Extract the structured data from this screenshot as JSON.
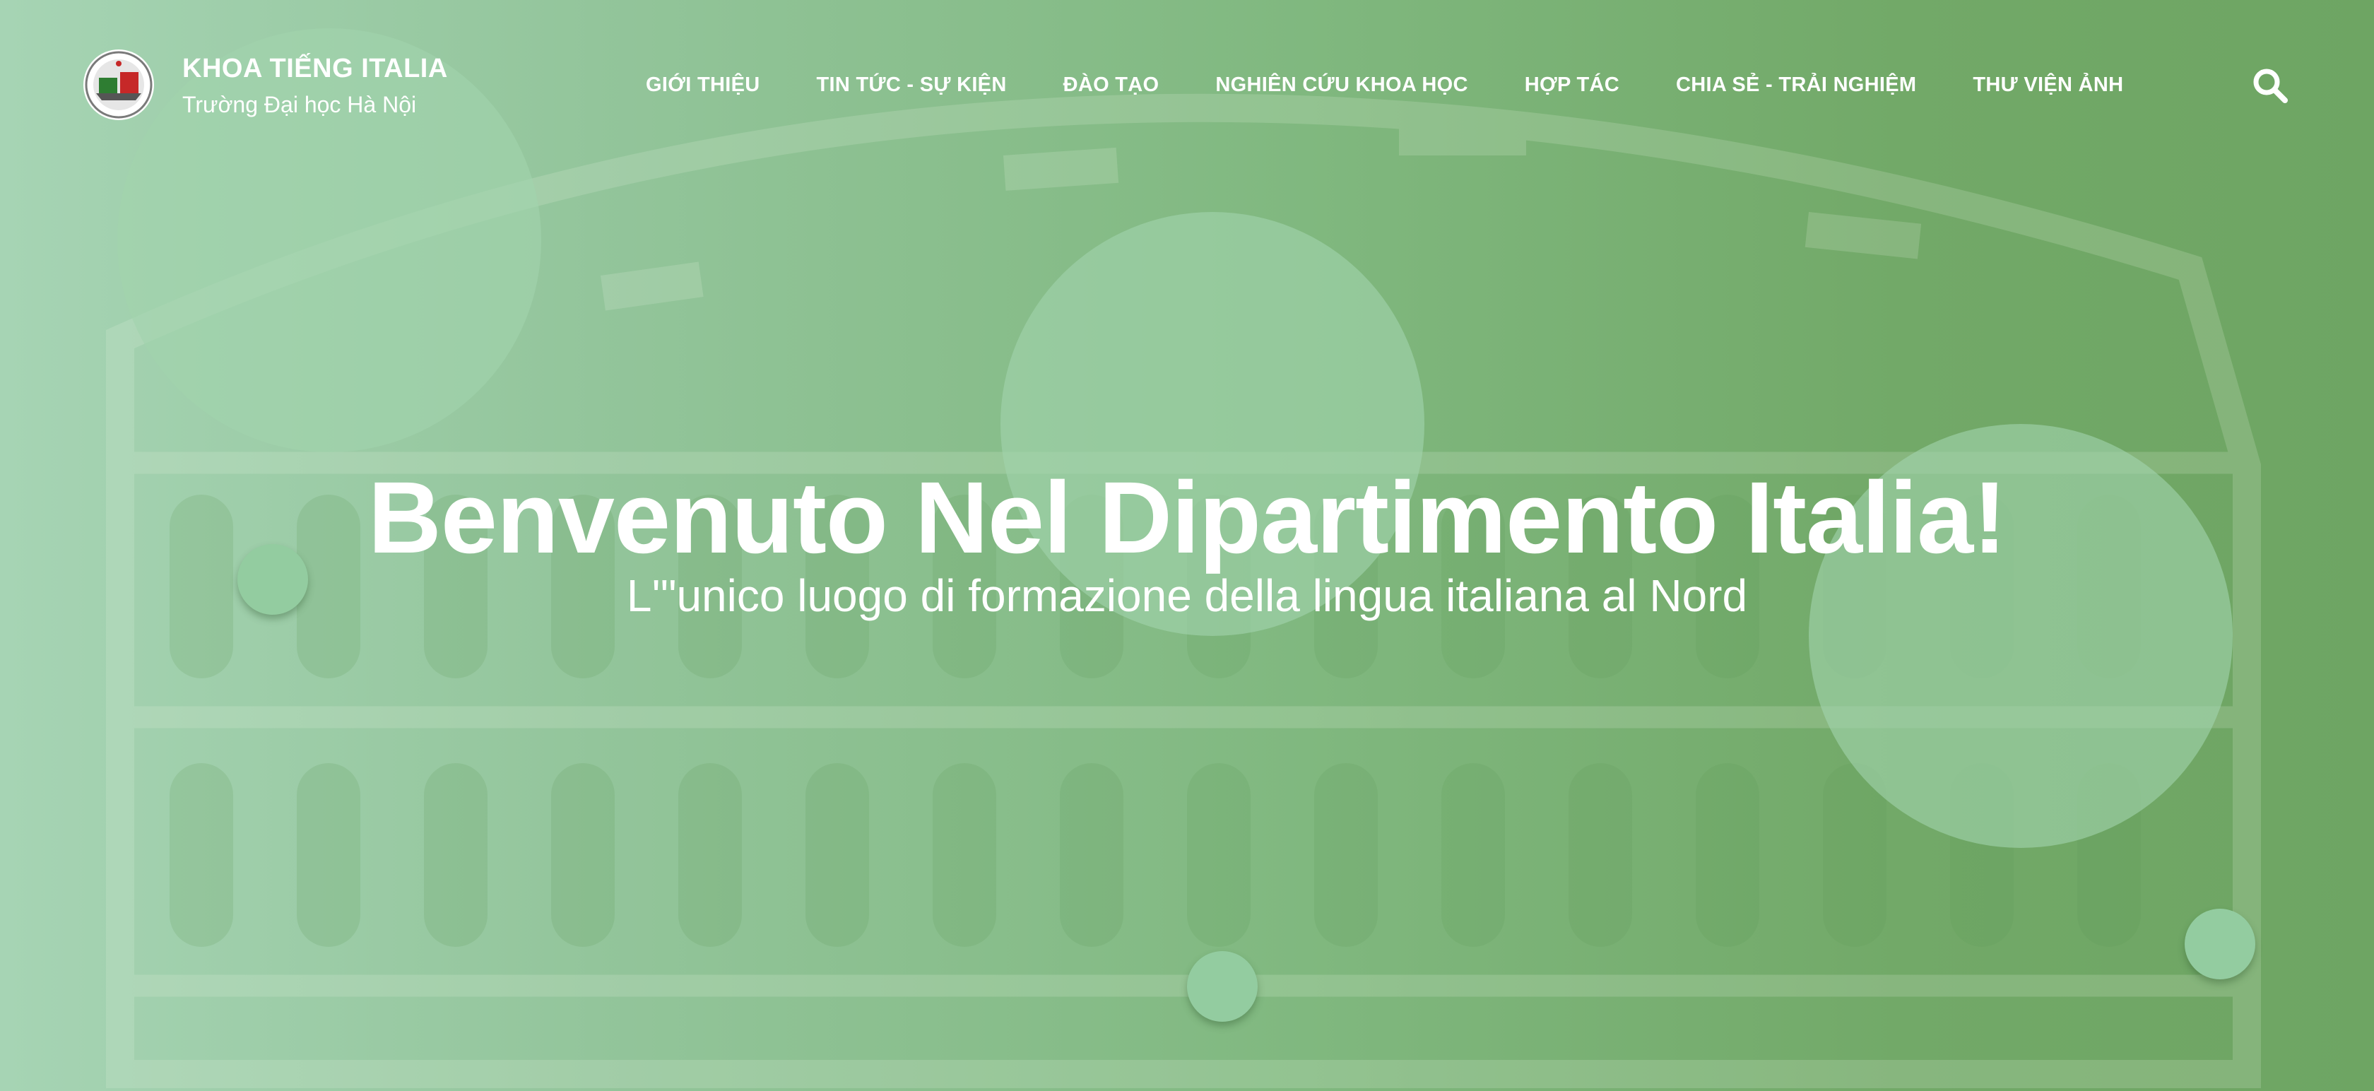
{
  "brand": {
    "title": "KHOA TIẾNG ITALIA",
    "subtitle": "Trường Đại học Hà Nội"
  },
  "nav": {
    "items": [
      {
        "label": "GIỚI THIỆU"
      },
      {
        "label": "TIN TỨC - SỰ KIỆN"
      },
      {
        "label": "ĐÀO TẠO"
      },
      {
        "label": "NGHIÊN CỨU KHOA HỌC"
      },
      {
        "label": "HỢP TÁC"
      },
      {
        "label": "CHIA SẺ - TRẢI NGHIỆM"
      },
      {
        "label": "THƯ VIỆN ẢNH"
      }
    ]
  },
  "search": {
    "icon": "search-icon"
  },
  "hero": {
    "title": "Benvenuto Nel Dipartimento Italia!",
    "subtitle": "L'\"unico luogo di formazione della lingua italiana al Nord"
  },
  "colors": {
    "background_left": "#a6d4b4",
    "background_right": "#6ea563",
    "bubble": "#a1d3ad",
    "text": "#ffffff"
  }
}
